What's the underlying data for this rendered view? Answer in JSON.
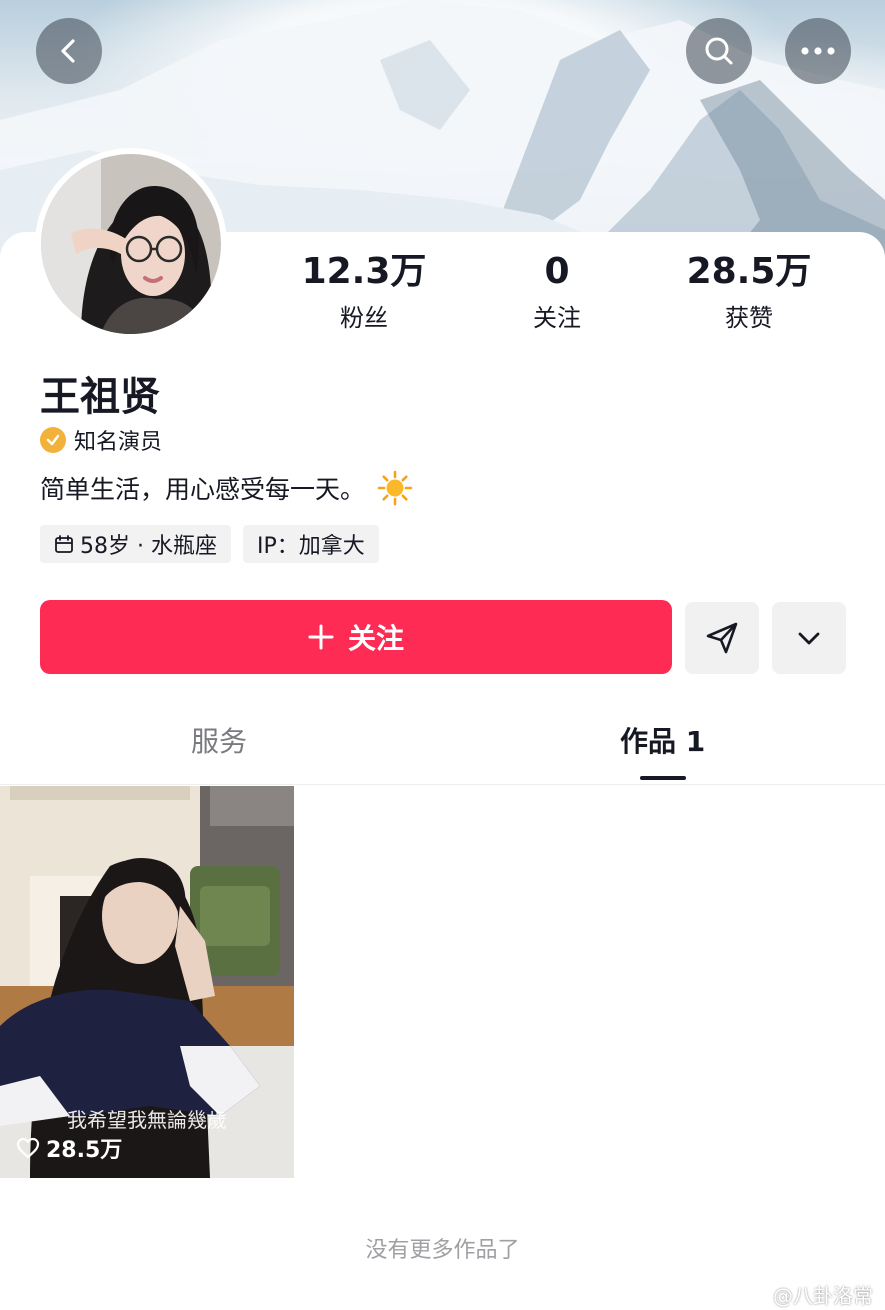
{
  "profile": {
    "name": "王祖贤",
    "verification": "知名演员",
    "bio": "简单生活，用心感受每一天。",
    "tags": [
      "58岁 · 水瓶座",
      "IP：加拿大"
    ]
  },
  "stats": [
    {
      "value": "12.3万",
      "label": "粉丝"
    },
    {
      "value": "0",
      "label": "关注"
    },
    {
      "value": "28.5万",
      "label": "获赞"
    }
  ],
  "actions": {
    "follow_label": "关注"
  },
  "tabs": [
    {
      "label": "服务"
    },
    {
      "label": "作品 1"
    }
  ],
  "works": [
    {
      "caption": "我希望我無論幾歲",
      "likes": "28.5万"
    }
  ],
  "footer": "没有更多作品了",
  "watermark": "@八卦洛常",
  "colors": {
    "accent": "#fe2c55",
    "badge": "#f2b23a"
  },
  "icons": [
    "back-icon",
    "search-icon",
    "more-icon",
    "verified-icon",
    "sun-emoji-icon",
    "calendar-icon",
    "plus-icon",
    "send-icon",
    "chevron-down-icon",
    "heart-icon"
  ]
}
